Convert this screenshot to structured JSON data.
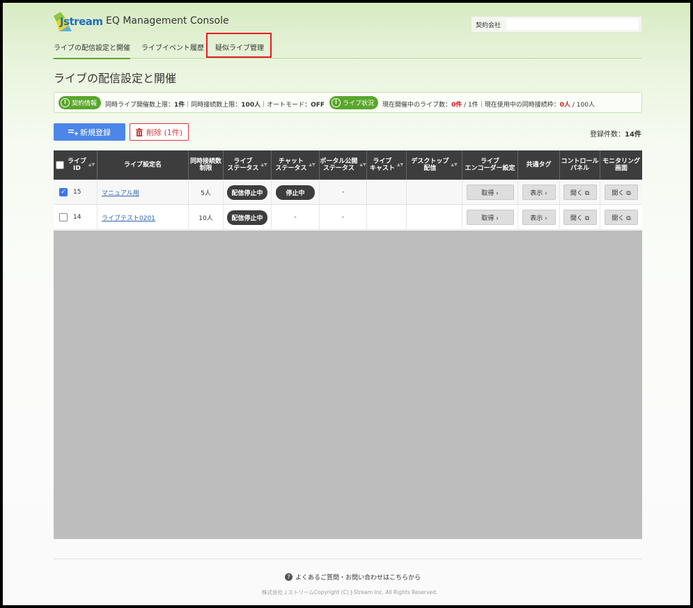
{
  "header": {
    "logo_text": "Jstream",
    "app_title": "EQ Management Console",
    "contract_label": "契約会社",
    "contract_value": ""
  },
  "tabs": [
    {
      "label": "ライブの配信設定と開催",
      "active": true
    },
    {
      "label": "ライブイベント履歴",
      "active": false
    },
    {
      "label": "疑似ライブ管理",
      "active": false
    }
  ],
  "page_title": "ライブの配信設定と開催",
  "info": {
    "contract_pill": "契約情報",
    "contract_text_1": "同時ライブ開催数上限：",
    "contract_val_1": "1件",
    "contract_text_2": "｜同時接続数上限：",
    "contract_val_2": "100人",
    "contract_text_3": "｜オートモード：",
    "contract_val_3": "OFF",
    "status_pill": "ライブ状況",
    "status_text_1": "現在開催中のライブ数：",
    "status_val_1": "0件",
    "status_text_2": " / 1件｜現在使用中の同時接続枠：",
    "status_val_2": "0人",
    "status_text_3": " / 100人"
  },
  "actions": {
    "new_label": "新規登録",
    "delete_label": "削除 (1件)",
    "reg_count_label": "登録件数：",
    "reg_count_value": "14件"
  },
  "table": {
    "headers": [
      "ライブ\nID",
      "ライブ設定名",
      "同時接続数\n制限",
      "ライブ\nステータス",
      "チャット\nステータス",
      "ポータル公開\nステータス",
      "ライブ\nキャスト",
      "デスクトップ\n配信",
      "ライブ\nエンコーダー設定",
      "共通タグ",
      "コントロール\nパネル",
      "モニタリング\n画面"
    ],
    "rows": [
      {
        "checked": true,
        "id": "15",
        "name": "マニュアル用",
        "limit": "5人",
        "live_status": "配信停止中",
        "chat_status": "停止中",
        "portal_status": "-",
        "cast": "",
        "desktop": "",
        "encoder": "取得 ›",
        "tag": "表示 ›",
        "control": "開く ⧉",
        "monitor": "開く ⧉"
      },
      {
        "checked": false,
        "id": "14",
        "name": "ライブテスト0201",
        "limit": "10人",
        "live_status": "配信停止中",
        "chat_status": "-",
        "portal_status": "-",
        "cast": "",
        "desktop": "",
        "encoder": "取得 ›",
        "tag": "表示 ›",
        "control": "開く ⧉",
        "monitor": "開く ⧉"
      }
    ]
  },
  "footer": {
    "faq": "よくあるご質問・お問い合わせはこちらから",
    "copyright": "株式会社ＪストリームCopyright (C) J-Stream Inc. All Rights Reserved."
  },
  "colors": {
    "accent_green": "#5aa62c",
    "primary_blue": "#4b86e8",
    "danger_red": "#d23a3a",
    "highlight_red": "#e51c23"
  }
}
